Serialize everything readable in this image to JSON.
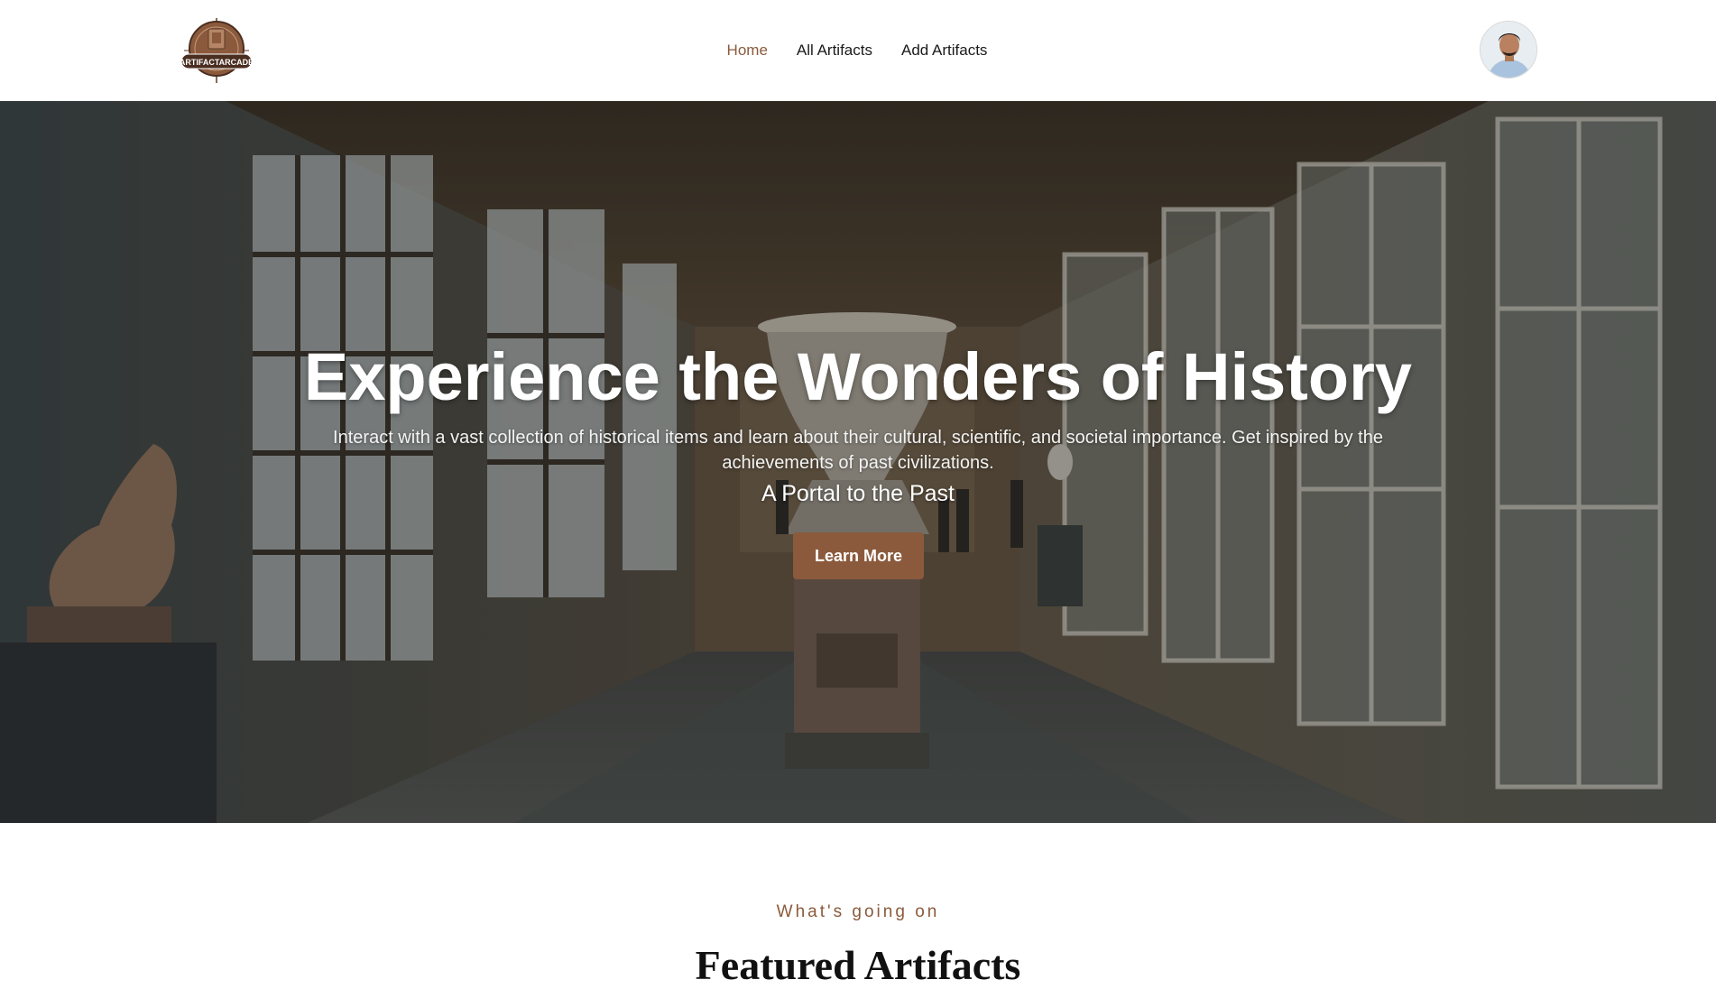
{
  "brand": {
    "logo_text": "ARTIFACTARCADE",
    "logo_color": "#8b5a3c"
  },
  "nav": {
    "items": [
      {
        "label": "Home",
        "active": true
      },
      {
        "label": "All Artifacts",
        "active": false
      },
      {
        "label": "Add Artifacts",
        "active": false
      }
    ],
    "active_color": "#8b5a3c"
  },
  "user": {
    "avatar_icon": "user-avatar"
  },
  "hero": {
    "title": "Experience the Wonders of History",
    "description": "Interact with a vast collection of historical items and learn about their cultural, scientific, and societal importance. Get inspired by the achievements of past civilizations.",
    "tagline": "A Portal to the Past",
    "button_label": "Learn More",
    "button_color": "#8b5a3c"
  },
  "featured": {
    "kicker": "What's going on",
    "title": "Featured Artifacts"
  }
}
